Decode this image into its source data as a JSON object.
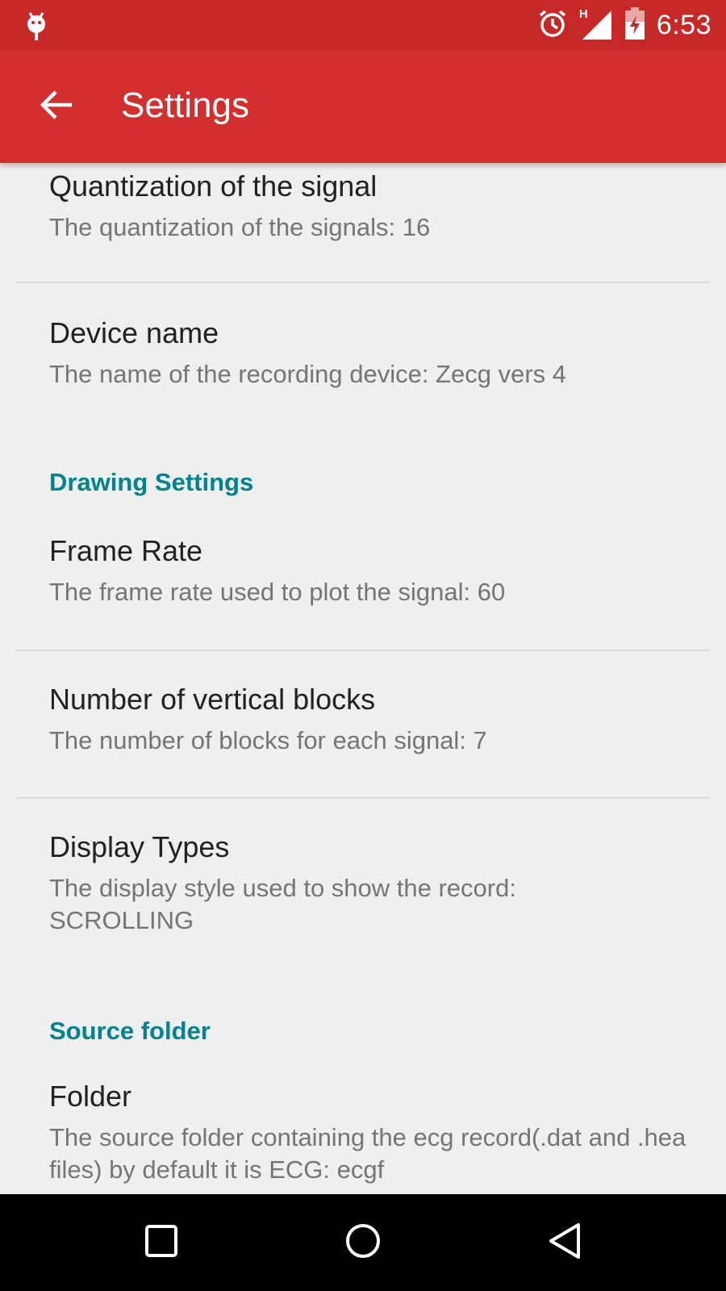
{
  "status_bar": {
    "time": "6:53",
    "network_label": "H",
    "icons": [
      "android-debug-icon",
      "alarm-icon",
      "signal-icon",
      "battery-charging-icon"
    ]
  },
  "app_bar": {
    "title": "Settings",
    "back_icon": "arrow-back-icon"
  },
  "preferences": [
    {
      "title": "Quantization of the signal",
      "summary": "The quantization of the signals: 16"
    },
    {
      "title": "Device name",
      "summary": "The name of the recording device: Zecg vers 4"
    },
    {
      "category": "Drawing Settings"
    },
    {
      "title": "Frame Rate",
      "summary": "The frame rate used to plot the signal: 60"
    },
    {
      "title": "Number of vertical blocks",
      "summary": "The number of blocks for each signal: 7"
    },
    {
      "title": "Display Types",
      "summary": "The display style used to show the record: SCROLLING"
    },
    {
      "category": "Source folder"
    },
    {
      "title": "Folder",
      "summary": "The source folder containing the ecg record(.dat and .hea files) by default it is ECG: ecgf"
    }
  ],
  "nav_bar": {
    "buttons": [
      "recents-icon",
      "home-icon",
      "back-icon"
    ]
  },
  "colors": {
    "status_bar": "#c62828",
    "app_bar": "#d32f2f",
    "category_text": "#00838f",
    "title_text": "#212121",
    "summary_text": "#757575",
    "background": "#efefef"
  }
}
